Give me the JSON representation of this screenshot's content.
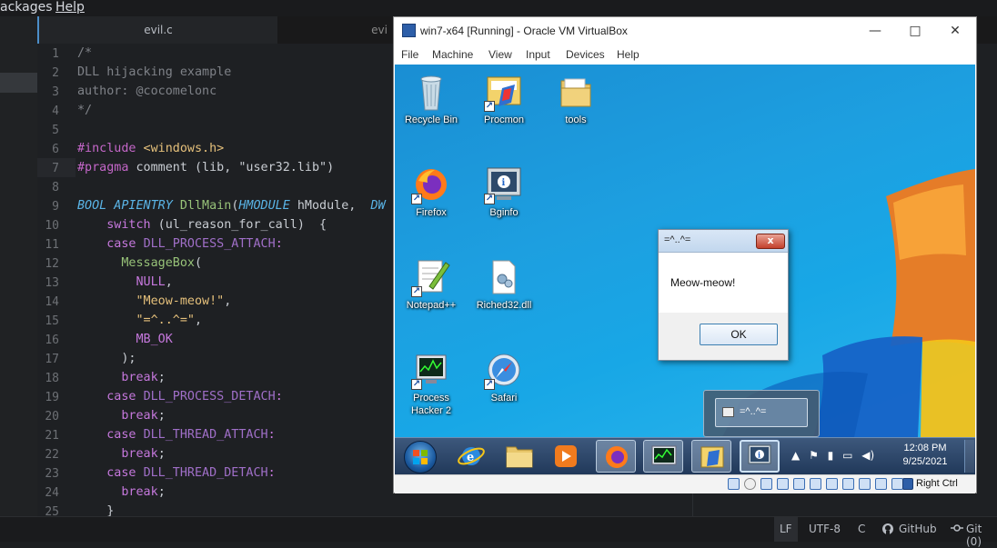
{
  "editor": {
    "menu": [
      "ackages",
      "Help"
    ],
    "tabs": [
      "evil.c",
      "evi"
    ],
    "line_numbers": [
      "1",
      "2",
      "3",
      "4",
      "5",
      "6",
      "7",
      "8",
      "9",
      "10",
      "11",
      "12",
      "13",
      "14",
      "15",
      "16",
      "17",
      "18",
      "19",
      "20",
      "21",
      "22",
      "23",
      "24",
      "25"
    ],
    "code": {
      "l1": "/*",
      "l2": "DLL hijacking example",
      "l3": "author: @cocomelonc",
      "l4": "*/",
      "l6a": "#include",
      "l6b": " <windows.h>",
      "l7a": "#pragma",
      "l7b": " comment (lib, ",
      "l7c": "\"user32.lib\"",
      "l7d": ")",
      "l9a": "BOOL APIENTRY ",
      "l9b": "DllMain",
      "l9c": "(",
      "l9d": "HMODULE",
      "l9e": " hModule,  ",
      "l9f": "DW",
      "l10a": "    switch",
      "l10b": " (ul_reason_for_call)  {",
      "l11a": "    case ",
      "l11b": "DLL_PROCESS_ATTACH",
      "l11c": ":",
      "l12a": "      MessageBox",
      "l12b": "(",
      "l13": "        NULL",
      "l13b": ",",
      "l14": "        \"Meow-meow!\"",
      "l14b": ",",
      "l15": "        \"=^..^=\"",
      "l15b": ",",
      "l16": "        MB_OK",
      "l17": "      );",
      "l18a": "      break",
      "l18b": ";",
      "l19a": "    case ",
      "l19b": "DLL_PROCESS_DETACH",
      "l19c": ":",
      "l20a": "      break",
      "l20b": ";",
      "l21a": "    case ",
      "l21b": "DLL_THREAD_ATTACH",
      "l21c": ":",
      "l22a": "      break",
      "l22b": ";",
      "l23a": "    case ",
      "l23b": "DLL_THREAD_DETACH",
      "l23c": ":",
      "l24a": "      break",
      "l24b": ";",
      "l25": "    }"
    },
    "status": {
      "line_ending": "LF",
      "encoding": "UTF-8",
      "grammar": "C",
      "github": "GitHub",
      "git": "Git (0)"
    }
  },
  "vbox": {
    "title": "win7-x64 [Running] - Oracle VM VirtualBox",
    "menu": [
      "File",
      "Machine",
      "View",
      "Input",
      "Devices",
      "Help"
    ],
    "host_key": "Right Ctrl"
  },
  "guest": {
    "icons": [
      "Recycle Bin",
      "Procmon",
      "tools",
      "Firefox",
      "Bginfo",
      "Notepad++",
      "Riched32.dll",
      "Process Hacker 2",
      "Safari"
    ],
    "dialog": {
      "title": "=^..^=",
      "message": "Meow-meow!",
      "ok": "OK",
      "close": "x"
    },
    "thumbnail": "=^..^=",
    "clock_time": "12:08 PM",
    "clock_date": "9/25/2021"
  }
}
